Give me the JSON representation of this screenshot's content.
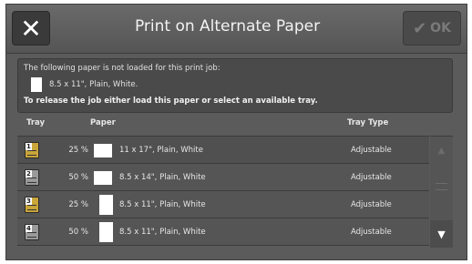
{
  "header": {
    "close_label": "✕",
    "title": "Print on Alternate Paper",
    "ok_label": "OK"
  },
  "message": {
    "line1": "The following paper is not loaded for this print job:",
    "paper": "8.5 x 11\", Plain, White.",
    "line3": "To release the job either load this paper or select an available tray."
  },
  "columns": {
    "tray": "Tray",
    "paper": "Paper",
    "tray_type": "Tray Type"
  },
  "rows": [
    {
      "tray_number": "1",
      "percent": "25 %",
      "paper": "11 x 17\", Plain, White",
      "tray_type": "Adjustable",
      "tray_color": "#c9a53a"
    },
    {
      "tray_number": "2",
      "percent": "50 %",
      "paper": "8.5 x 14\", Plain, White",
      "tray_type": "Adjustable",
      "tray_color": "#9a9a9a"
    },
    {
      "tray_number": "3",
      "percent": "25 %",
      "paper": "8.5 x 11\", Plain, White",
      "tray_type": "Adjustable",
      "tray_color": "#c9a53a"
    },
    {
      "tray_number": "4",
      "percent": "50 %",
      "paper": "8.5 x 11\", Plain, White",
      "tray_type": "Adjustable",
      "tray_color": "#9a9a9a"
    }
  ],
  "scroll": {
    "up_icon": "▲",
    "down_icon": "▼"
  }
}
